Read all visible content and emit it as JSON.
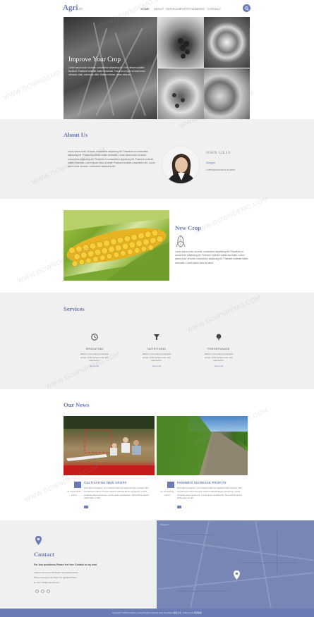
{
  "header": {
    "logo": "Agri",
    "logo_sub": "an",
    "nav": [
      "HOME",
      "ABOUT",
      "SERVICES",
      "PORTFOLIO",
      "NEWS",
      "CONTACT"
    ],
    "active_index": 0
  },
  "hero": {
    "title": "Improve Your Crop",
    "text": "Lorem ipsum dolor sit amet, consectetur adipiscing elit. Duis ultrices sodales tincidunt. Praesent molestie mattis venenatis. Fusce id semper sit amet tortor vehicula, vitae, commodo nibh. Nullam ultricies, lorem vitae ac."
  },
  "about": {
    "title": "About Us",
    "text": "Lorem ipsum dolor sit amet, consectetur adipiscing elit. Phasellus eu consectetur adipiscing elit. Praesent molestie mattis venenatis. Lorem ipsum dolor sit amet, consectetur adipiscing elit. Phasellus eu consectetur adipiscing elit. Praesent molestie mattis venenatis. Lorem ipsum dolor sit amet. Praesent molestie consectetur elit. Lorem ipsum dolor sit amet, consectetur adipiscing elit.",
    "name": "JOHN LILLY",
    "role": "Designer",
    "small": "Lorem ipsum dolor sit amet"
  },
  "crop": {
    "title": "New Crop",
    "text": "Lorem ipsum dolor sit amet, consectetur adipiscing elit. Phasellus eu consectetur adipiscing elit. Praesent molestie mattis venenatis. Lorem ipsum dolor sit amet, consectetur adipiscing elit. Praesent molestie mattis venenatis. Lorem ipsum dolor sit amet."
  },
  "services": {
    "title": "Services",
    "items": [
      {
        "name": "IRRIGATION",
        "desc": "Morbi in sem quis dui placerat ornare. Pellentesque odio nisi, euismod in.",
        "more": "More Info"
      },
      {
        "name": "NUTRITIONS",
        "desc": "Morbi in sem quis dui placerat ornare. Pellentesque odio nisi, euismod in.",
        "more": "More Info"
      },
      {
        "name": "PRESERVANCE",
        "desc": "Morbi in sem quis dui placerat ornare. Pellentesque odio nisi, euismod in.",
        "more": "More Info"
      }
    ]
  },
  "news": {
    "title": "Our News",
    "items": [
      {
        "headline": "CULTIVATING NEW CROPS",
        "date": "14 Jul 2015 By Admin",
        "body": "Nam libero tempore, cum soluta nobis est eligendi optio cumque nihil impedit quo minus id quod maxime placeat facere possimus, omnis voluptas assumenda est, omnis dolor repellendus. Temporibus autem quibusdam et aut."
      },
      {
        "headline": "FARMERS INCREASE PROFITS",
        "date": "14 Jul 2015 By Admin",
        "body": "Nam libero tempore, cum soluta nobis est eligendi optio cumque nihil impedit quo minus id quod maxime placeat facere possimus, omnis voluptas assumenda est, omnis dolor repellendus. Temporibus autem quibusdam et aut."
      }
    ]
  },
  "contact": {
    "title": "Contact",
    "lead": "For Any questions,Please feel free Contact us by mail.",
    "lines": [
      "Address:Newyork 12d Road 7th grasland Place,",
      "Phone:Newyork 12d Road 7th grasland Place",
      "E-mail: mail@example.com"
    ]
  },
  "map": {
    "label": "Newyork"
  },
  "footer": {
    "text": "Copyright © 2015 Company name All rights reserved.More Templates 模板之家 - Collect from 网页模板"
  },
  "watermark": "WWW.DOWNDEMO.COM",
  "colors": {
    "accent": "#6a7bb5",
    "section_bg": "#f0f0f0",
    "map": "#7886b5"
  }
}
